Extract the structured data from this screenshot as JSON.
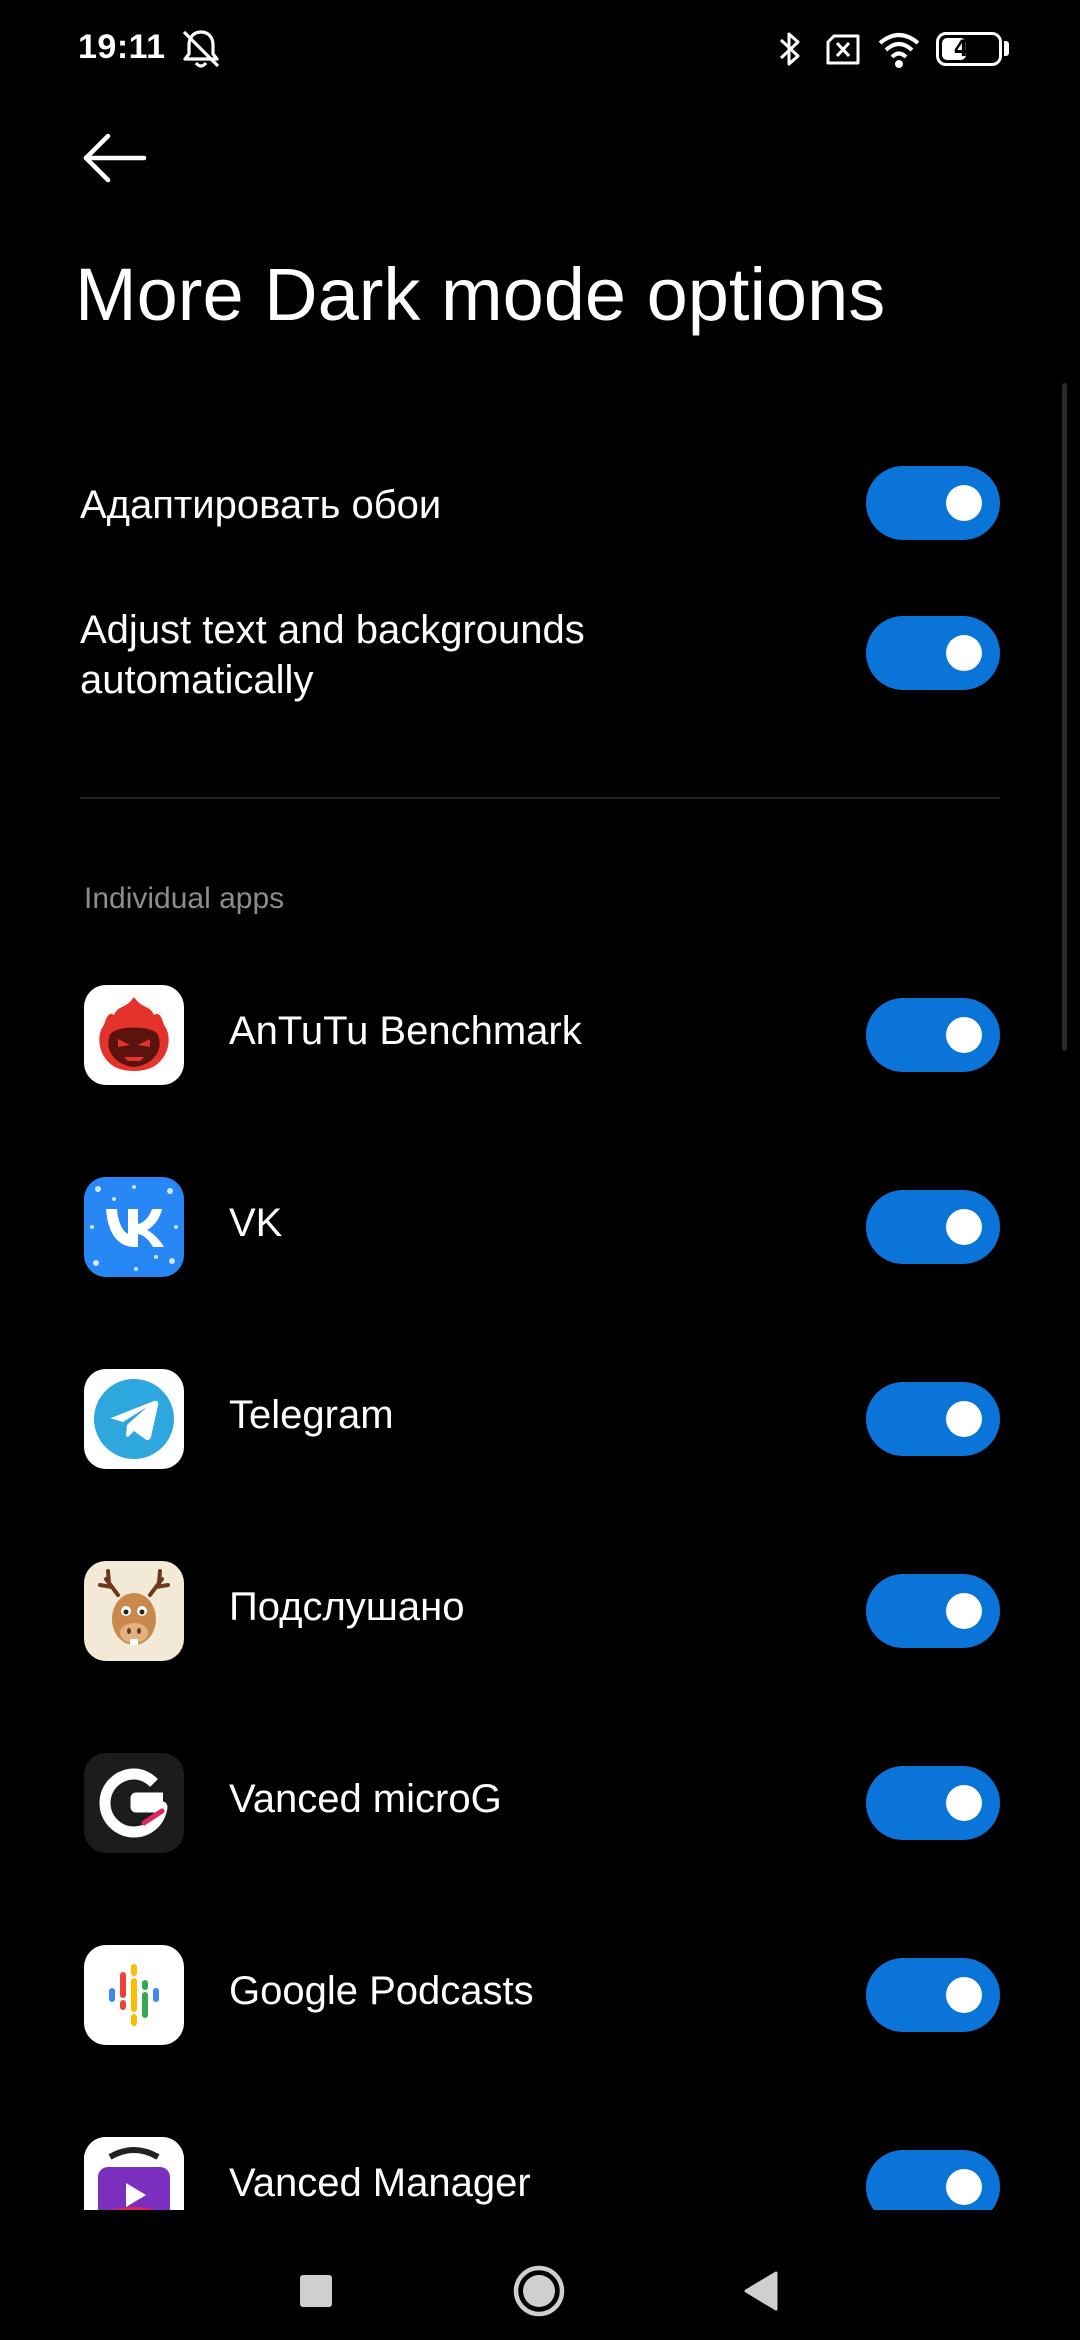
{
  "status_bar": {
    "time": "19:11",
    "battery": "44",
    "battery_level": 0.44,
    "icons": [
      "silent-bell-icon",
      "bluetooth-icon",
      "sim-missing-icon",
      "wifi-icon",
      "battery-icon"
    ]
  },
  "header": {
    "title": "More Dark mode options"
  },
  "settings": [
    {
      "label": "Адаптировать обои",
      "enabled": true
    },
    {
      "label_line1": "Adjust text and backgrounds",
      "label_line2": "automatically",
      "enabled": true
    }
  ],
  "section": {
    "title": "Individual apps"
  },
  "apps": [
    {
      "name": "AnTuTu Benchmark",
      "icon": "antutu-icon",
      "enabled": true
    },
    {
      "name": "VK",
      "icon": "vk-icon",
      "enabled": true
    },
    {
      "name": "Telegram",
      "icon": "telegram-icon",
      "enabled": true
    },
    {
      "name": "Подслушано",
      "icon": "podslushano-moose-icon",
      "enabled": true
    },
    {
      "name": "Vanced microG",
      "icon": "vanced-microg-icon",
      "enabled": true
    },
    {
      "name": "Google Podcasts",
      "icon": "google-podcasts-icon",
      "enabled": true
    },
    {
      "name": "Vanced Manager",
      "icon": "vanced-manager-icon",
      "enabled": true
    }
  ],
  "colors": {
    "background": "#000000",
    "toggle_on": "#0a74d8",
    "section_header": "#8c8c8c"
  },
  "navigation": {
    "buttons": [
      "recents-square-icon",
      "home-circle-icon",
      "back-triangle-icon"
    ]
  }
}
